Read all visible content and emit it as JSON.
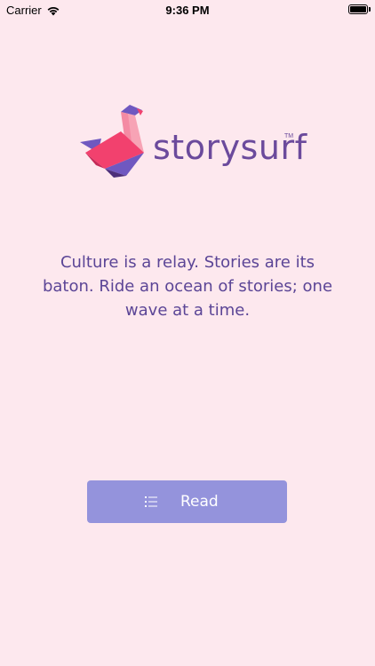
{
  "status_bar": {
    "carrier": "Carrier",
    "time": "9:36 PM",
    "wifi_icon": "wifi-icon",
    "battery_icon": "battery-icon"
  },
  "logo": {
    "wordmark": "storysurf",
    "trademark": "TM",
    "icon": "origami-bird-icon",
    "colors": {
      "pink": "#f2416e",
      "light_pink": "#f7a3b5",
      "purple": "#6f58c0",
      "dark": "#4c2f7a",
      "wordmark": "#6b4a9c"
    }
  },
  "tagline": {
    "text": "Culture is a relay. Stories are its baton. Ride an ocean of stories; one wave at a time."
  },
  "read_button": {
    "label": "Read",
    "icon": "list-icon",
    "color": "#9493dc"
  },
  "colors": {
    "background": "#fde8ee",
    "tagline": "#5b4596"
  }
}
